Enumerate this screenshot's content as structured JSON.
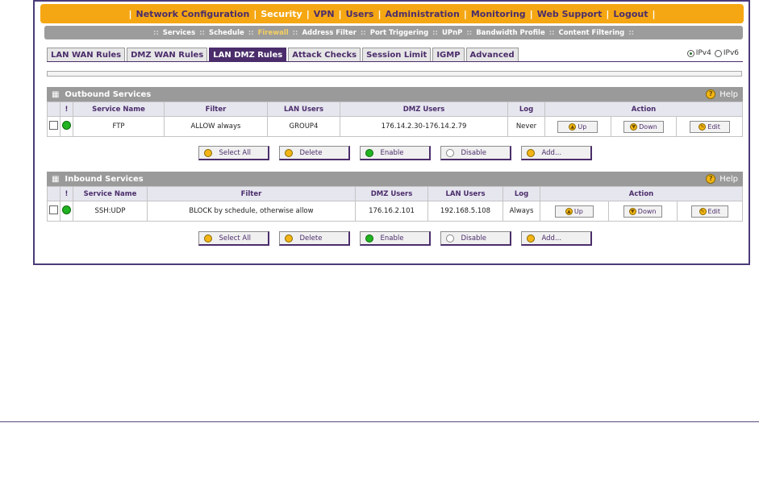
{
  "topnav": [
    "Network Configuration",
    "Security",
    "VPN",
    "Users",
    "Administration",
    "Monitoring",
    "Web Support",
    "Logout"
  ],
  "subnav": [
    "Services",
    "Schedule",
    "Firewall",
    "Address Filter",
    "Port Triggering",
    "UPnP",
    "Bandwidth Profile",
    "Content Filtering"
  ],
  "tabs": [
    "LAN WAN Rules",
    "DMZ WAN Rules",
    "LAN DMZ Rules",
    "Attack Checks",
    "Session Limit",
    "IGMP",
    "Advanced"
  ],
  "ip": {
    "v4": "IPv4",
    "v6": "IPv6"
  },
  "outbound": {
    "title": "Outbound Services",
    "help": "Help",
    "headers": [
      "!",
      "Service Name",
      "Filter",
      "LAN Users",
      "DMZ Users",
      "Log",
      "Action"
    ],
    "row": {
      "service": "FTP",
      "filter": "ALLOW always",
      "users1": "GROUP4",
      "users2": "176.14.2.30-176.14.2.79",
      "log": "Never"
    }
  },
  "inbound": {
    "title": "Inbound Services",
    "help": "Help",
    "headers": [
      "!",
      "Service Name",
      "Filter",
      "DMZ Users",
      "LAN Users",
      "Log",
      "Action"
    ],
    "row": {
      "service": "SSH:UDP",
      "filter": "BLOCK by schedule, otherwise allow",
      "users1": "176.16.2.101",
      "users2": "192.168.5.108",
      "log": "Always"
    }
  },
  "actions": {
    "up": "Up",
    "down": "Down",
    "edit": "Edit"
  },
  "buttons": {
    "select_all": "Select All",
    "delete": "Delete",
    "enable": "Enable",
    "disable": "Disable",
    "add": "Add..."
  }
}
